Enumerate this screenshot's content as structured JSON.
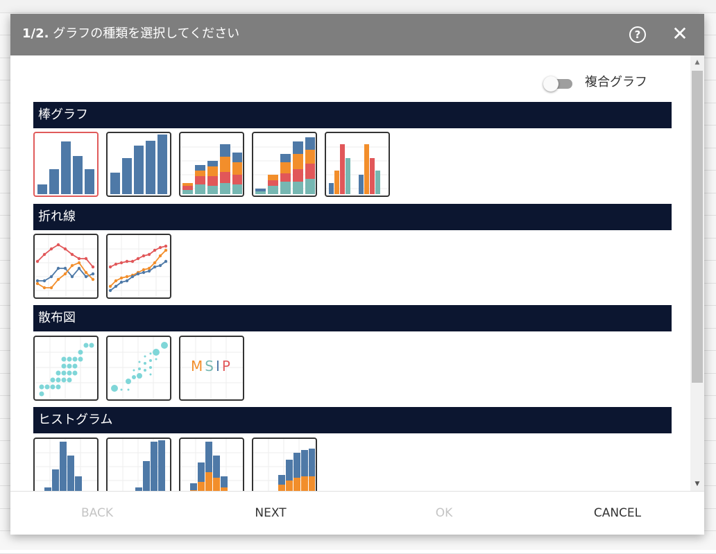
{
  "dialog": {
    "step": "1/2.",
    "title": "グラフの種類を選択してください",
    "help_icon": "?",
    "close_icon": "✕"
  },
  "toggle": {
    "label": "複合グラフ",
    "on": false
  },
  "sections": {
    "bar": "棒グラフ",
    "line": "折れ線",
    "scatter": "散布図",
    "histogram": "ヒストグラム"
  },
  "scatter_thumb_text": {
    "m": "M",
    "s": "S",
    "i": "I",
    "p": "P"
  },
  "footer": {
    "back": "BACK",
    "next": "NEXT",
    "ok": "OK",
    "cancel": "CANCEL"
  },
  "scrollbar": {
    "up_icon": "▲",
    "down_icon": "▼"
  },
  "colors": {
    "blue": "#4e79a7",
    "orange": "#f28e2b",
    "red": "#e15759",
    "teal": "#76b7b2",
    "cyan": "#7fd6d8",
    "header": "#0c1630",
    "title_bar": "#7e7e7e",
    "selected_border": "#e05a5a"
  }
}
